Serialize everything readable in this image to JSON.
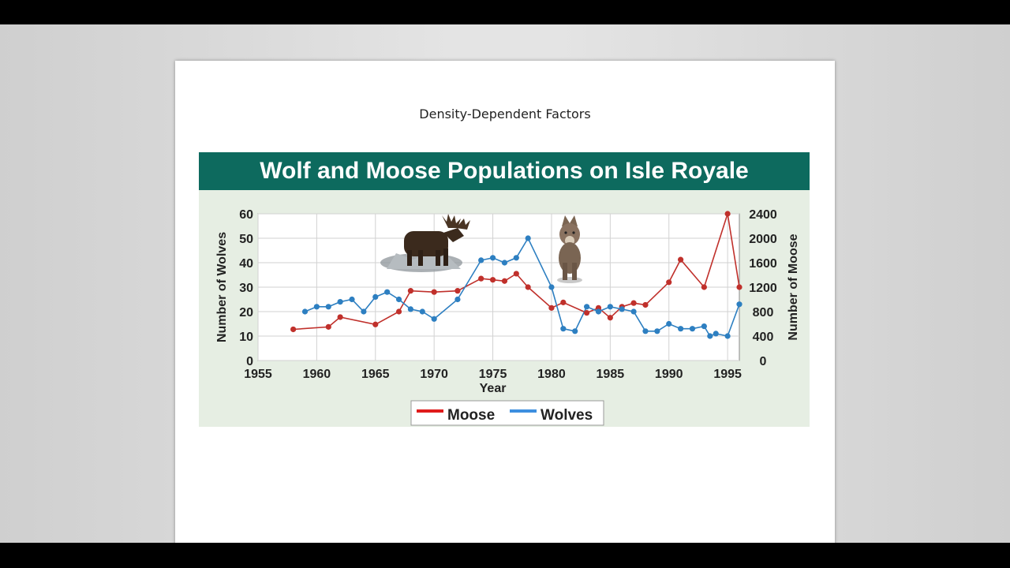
{
  "slide": {
    "title": "Density-Dependent Factors"
  },
  "chart_data": {
    "type": "line",
    "title": "Wolf and Moose Populations on Isle Royale",
    "xlabel": "Year",
    "ylabel_left": "Number of Wolves",
    "ylabel_right": "Number of Moose",
    "xlim": [
      1955,
      1996
    ],
    "ylim_left": [
      0,
      60
    ],
    "ylim_right": [
      0,
      2400
    ],
    "x_ticks": [
      1955,
      1960,
      1965,
      1970,
      1975,
      1980,
      1985,
      1990,
      1995
    ],
    "y_ticks_left": [
      0,
      10,
      20,
      30,
      40,
      50,
      60
    ],
    "y_ticks_right": [
      0,
      400,
      800,
      1200,
      1600,
      2000,
      2400
    ],
    "grid": true,
    "legend_position": "bottom-center",
    "colors": {
      "moose": "#c0302b",
      "wolves": "#2d7fc1",
      "moose_legend": "#e01b1b",
      "wolves_legend": "#3d8fe0",
      "banner": "#0d6a5e",
      "plot_bg": "#e6eee3"
    },
    "series": [
      {
        "name": "Moose",
        "axis": "right",
        "points": [
          [
            1958,
            510
          ],
          [
            1961,
            550
          ],
          [
            1962,
            710
          ],
          [
            1965,
            590
          ],
          [
            1967,
            800
          ],
          [
            1968,
            1140
          ],
          [
            1970,
            1120
          ],
          [
            1972,
            1140
          ],
          [
            1974,
            1340
          ],
          [
            1975,
            1320
          ],
          [
            1976,
            1300
          ],
          [
            1977,
            1420
          ],
          [
            1978,
            1200
          ],
          [
            1980,
            860
          ],
          [
            1981,
            950
          ],
          [
            1983,
            780
          ],
          [
            1984,
            860
          ],
          [
            1985,
            700
          ],
          [
            1986,
            880
          ],
          [
            1987,
            940
          ],
          [
            1988,
            910
          ],
          [
            1990,
            1280
          ],
          [
            1991,
            1650
          ],
          [
            1993,
            1200
          ],
          [
            1995,
            2400
          ],
          [
            1996,
            1200
          ]
        ]
      },
      {
        "name": "Wolves",
        "axis": "left",
        "points": [
          [
            1959,
            20
          ],
          [
            1960,
            22
          ],
          [
            1961,
            22
          ],
          [
            1962,
            24
          ],
          [
            1963,
            25
          ],
          [
            1964,
            20
          ],
          [
            1965,
            26
          ],
          [
            1966,
            28
          ],
          [
            1967,
            25
          ],
          [
            1968,
            21
          ],
          [
            1969,
            20
          ],
          [
            1970,
            17
          ],
          [
            1972,
            25
          ],
          [
            1974,
            41
          ],
          [
            1975,
            42
          ],
          [
            1976,
            40
          ],
          [
            1977,
            42
          ],
          [
            1978,
            50
          ],
          [
            1980,
            30
          ],
          [
            1981,
            13
          ],
          [
            1982,
            12
          ],
          [
            1983,
            22
          ],
          [
            1984,
            20
          ],
          [
            1985,
            22
          ],
          [
            1986,
            21
          ],
          [
            1987,
            20
          ],
          [
            1988,
            12
          ],
          [
            1989,
            12
          ],
          [
            1990,
            15
          ],
          [
            1991,
            13
          ],
          [
            1992,
            13
          ],
          [
            1993,
            14
          ],
          [
            1993.5,
            10
          ],
          [
            1994,
            11
          ],
          [
            1995,
            10
          ],
          [
            1996,
            23
          ]
        ]
      }
    ]
  }
}
